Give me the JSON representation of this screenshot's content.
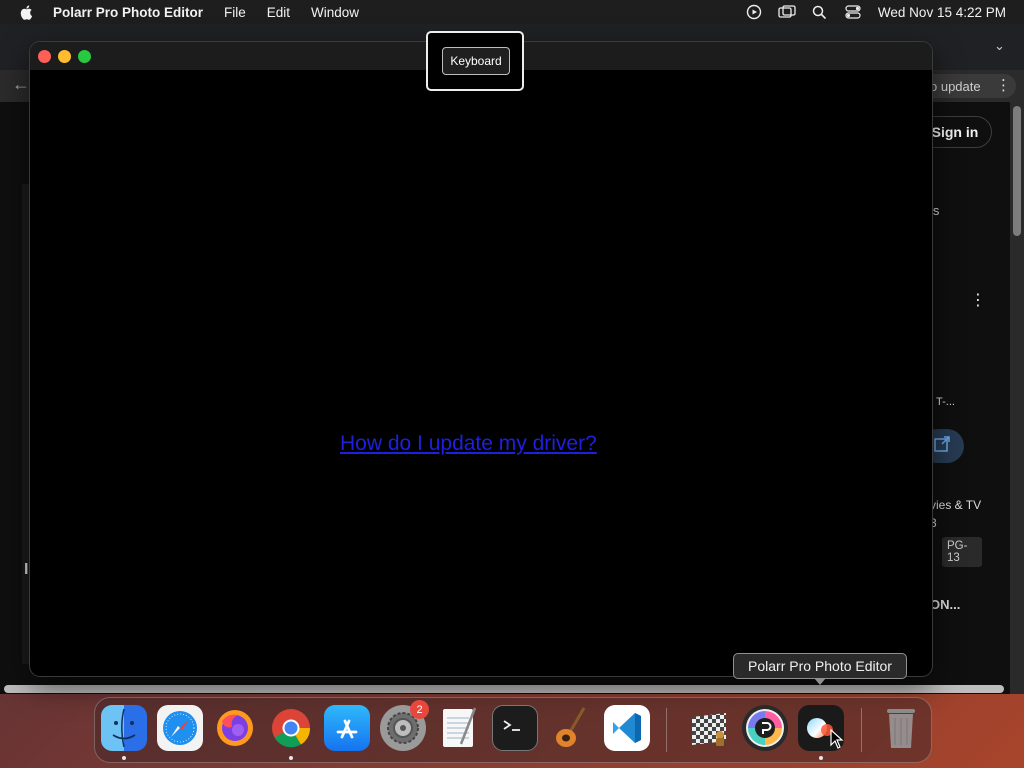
{
  "menubar": {
    "app_name": "Polarr Pro Photo Editor",
    "menus": [
      "File",
      "Edit",
      "Window"
    ],
    "clock": "Wed Nov 15  4:22 PM",
    "status_icons": [
      "screen-record-icon",
      "screen-mirror-icon",
      "spotlight-search-icon",
      "control-center-icon"
    ]
  },
  "background_browser": {
    "update_label": "o update",
    "signin_label": "Sign in",
    "fragments": {
      "t1": "is",
      "t2": "T-...",
      "t3": "vies & TV",
      "t4": "3",
      "t5": "ON...",
      "t6": "I"
    },
    "rating": "PG-\n13"
  },
  "app_window": {
    "link_text": "How do I update my driver?"
  },
  "keyboard_popup": {
    "button_label": "Keyboard"
  },
  "dock": {
    "tooltip": "Polarr Pro Photo Editor",
    "items": [
      {
        "name": "Finder",
        "icon": "finder-icon"
      },
      {
        "name": "Safari",
        "icon": "safari-icon"
      },
      {
        "name": "Firefox",
        "icon": "firefox-icon"
      },
      {
        "name": "Chrome",
        "icon": "chrome-icon"
      },
      {
        "name": "App Store",
        "icon": "app-store-icon"
      },
      {
        "name": "System Settings",
        "icon": "system-settings-icon",
        "badge": "2"
      },
      {
        "name": "TextEdit",
        "icon": "textedit-icon"
      },
      {
        "name": "Terminal",
        "icon": "terminal-icon"
      },
      {
        "name": "GarageBand",
        "icon": "garageband-icon"
      },
      {
        "name": "VS Code",
        "icon": "vscode-icon"
      },
      {
        "name": "Chess",
        "icon": "chess-icon"
      },
      {
        "name": "Polarr",
        "icon": "polarr-icon"
      },
      {
        "name": "Polarr Pro Photo Editor",
        "icon": "polarr-pro-icon"
      },
      {
        "name": "Trash",
        "icon": "trash-icon"
      }
    ]
  },
  "colors": {
    "link": "#1f1fe0",
    "close": "#ff5f57",
    "minimize": "#febc2e",
    "zoom": "#28c840"
  }
}
